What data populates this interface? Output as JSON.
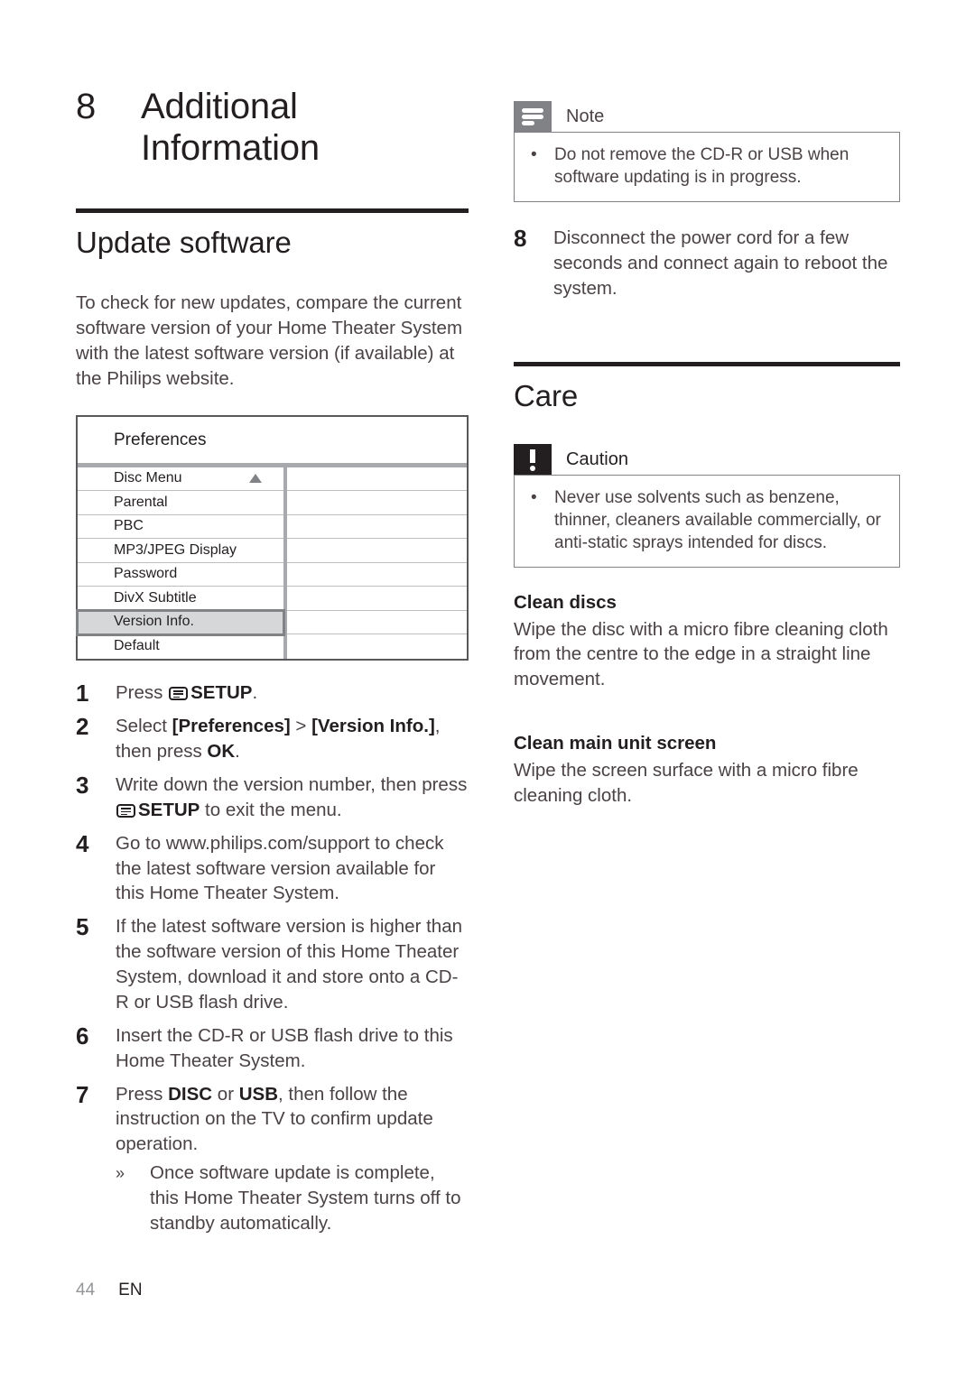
{
  "chapter": {
    "number": "8",
    "title_lines": [
      "Additional",
      "Information"
    ]
  },
  "left_column": {
    "section_title": "Update software",
    "intro": "To check for new updates, compare the current software version of your Home Theater System with the latest software version (if available) at the Philips website.",
    "osd": {
      "title": "Preferences",
      "rows": [
        {
          "label": "Disc Menu",
          "caret": "up-caret",
          "selected": false
        },
        {
          "label": "Parental",
          "selected": false
        },
        {
          "label": "PBC",
          "selected": false
        },
        {
          "label": "MP3/JPEG Display",
          "selected": false
        },
        {
          "label": "Password",
          "selected": false
        },
        {
          "label": "DivX Subtitle",
          "selected": false
        },
        {
          "label": "Version Info.",
          "selected": true
        },
        {
          "label": "Default",
          "selected": false
        }
      ]
    },
    "steps": [
      {
        "num": "1",
        "parts": [
          {
            "t": "Press "
          },
          {
            "icon": "setup-icon"
          },
          {
            "t": "SETUP",
            "b": true
          },
          {
            "t": "."
          }
        ]
      },
      {
        "num": "2",
        "parts": [
          {
            "t": "Select "
          },
          {
            "t": "[Preferences]",
            "b": true
          },
          {
            "t": " > "
          },
          {
            "t": "[Version Info.]",
            "b": true
          },
          {
            "t": ", then press "
          },
          {
            "t": "OK",
            "b": true
          },
          {
            "t": "."
          }
        ]
      },
      {
        "num": "3",
        "parts": [
          {
            "t": "Write down the version number, then press "
          },
          {
            "icon": "setup-icon"
          },
          {
            "t": "SETUP",
            "b": true
          },
          {
            "t": " to exit the menu."
          }
        ]
      },
      {
        "num": "4",
        "parts": [
          {
            "t": "Go to www.philips.com/support to check the latest software version available for this Home Theater System."
          }
        ]
      },
      {
        "num": "5",
        "parts": [
          {
            "t": "If the latest software version is higher than the software version of this Home Theater System, download it and store onto a CD-R or USB flash drive."
          }
        ]
      },
      {
        "num": "6",
        "parts": [
          {
            "t": "Insert the CD-R or USB flash drive to this Home Theater System."
          }
        ]
      },
      {
        "num": "7",
        "parts": [
          {
            "t": "Press "
          },
          {
            "t": "DISC",
            "b": true
          },
          {
            "t": " or "
          },
          {
            "t": "USB",
            "b": true
          },
          {
            "t": ", then follow the instruction on the TV to confirm update operation."
          }
        ],
        "subitems": [
          {
            "mark": "»",
            "text": "Once software update is complete, this Home Theater System turns off to standby automatically."
          }
        ]
      }
    ]
  },
  "right_column": {
    "note": {
      "label": "Note",
      "icon": "note-lines-icon",
      "items": [
        {
          "bullet": "•",
          "text": "Do not remove the CD-R or USB when software updating is in progress."
        }
      ]
    },
    "step8": {
      "num": "8",
      "text": "Disconnect the power cord for a few seconds and connect again to reboot the system."
    },
    "section_title": "Care",
    "caution": {
      "label": "Caution",
      "icon": "exclamation-icon",
      "items": [
        {
          "bullet": "•",
          "text": "Never use solvents such as benzene, thinner, cleaners available commercially, or anti-static sprays intended for discs."
        }
      ]
    },
    "clean_discs": {
      "heading": "Clean discs",
      "text": "Wipe the disc with a micro fibre cleaning cloth from the centre to the edge in a straight line movement."
    },
    "clean_screen": {
      "heading": "Clean main unit screen",
      "text": "Wipe the screen surface with a micro fibre cleaning cloth."
    }
  },
  "footer": {
    "page_number": "44",
    "language": "EN"
  },
  "colors": {
    "heading": "#231f20",
    "body": "#4a4245",
    "rule": "#231f20",
    "note_icon_bg": "#808285",
    "caution_icon_bg": "#231f20",
    "osd_border": "#58585b",
    "osd_divider": "#a7a9ac",
    "osd_selected_bg": "#d5d7d8",
    "osd_selected_border": "#808285",
    "page_number": "#939598"
  }
}
